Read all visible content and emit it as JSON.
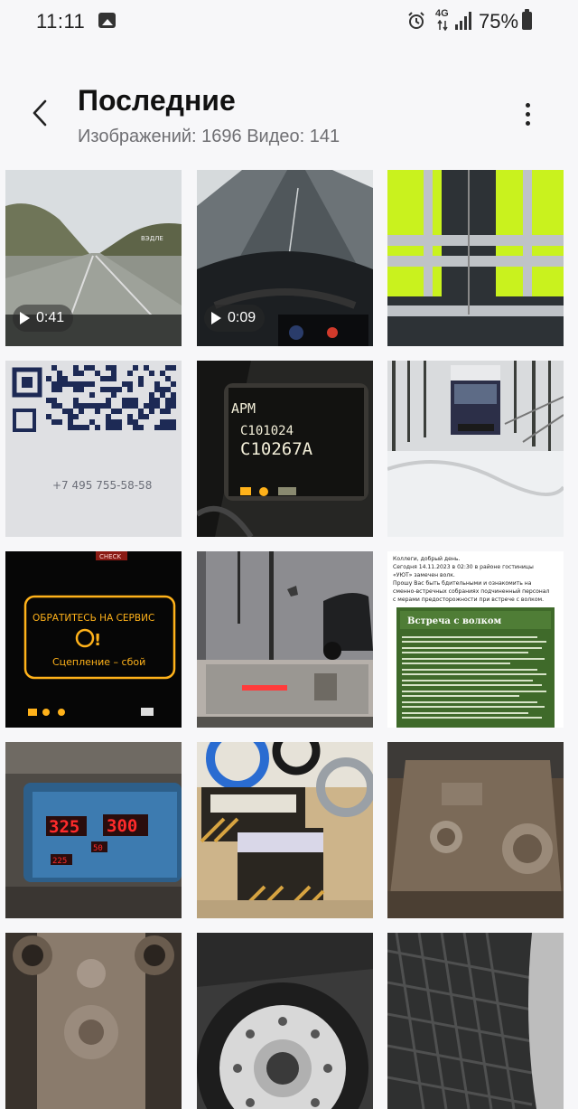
{
  "status_bar": {
    "time": "11:11",
    "network": "4G",
    "battery": "75%"
  },
  "header": {
    "title": "Последние",
    "images_label": "Изображений: 1696",
    "videos_label": "Видео: 141"
  },
  "tiles": {
    "t1": {
      "duration": "0:41",
      "watermark": "ВЭДЛЕ"
    },
    "t2": {
      "duration": "0:09"
    },
    "t4": {
      "phone": "+7 495 755-58-58"
    },
    "t5": {
      "label": "APM",
      "code1": "C101024",
      "code2": "C10267A"
    },
    "t7": {
      "line1": "ОБРАТИТЕСЬ НА СЕРВИС",
      "line2": "Сцепление – сбой",
      "top": "CHECK"
    },
    "t9": {
      "p1": "Коллеги, добрый день.",
      "p2": "Сегодня 14.11.2023 в 02:30 в районе гостиницы",
      "p3": "«УЮТ» замечен волк.",
      "p4": "Прошу Вас быть бдительными и ознакомить на",
      "p5": "сменно-встречных собраниях подчиненный персонал",
      "p6": "с мерами предосторожности при встрече с волком.",
      "box_title": "Встреча с волком"
    },
    "t10": {
      "left": "325",
      "right": "300",
      "small1": "50",
      "small2": "225"
    }
  },
  "colors": {
    "vest": "#c9f21e",
    "poster_green": "#3f6a2a",
    "red_display": "#ff2b2b",
    "amber": "#ffb21a"
  }
}
